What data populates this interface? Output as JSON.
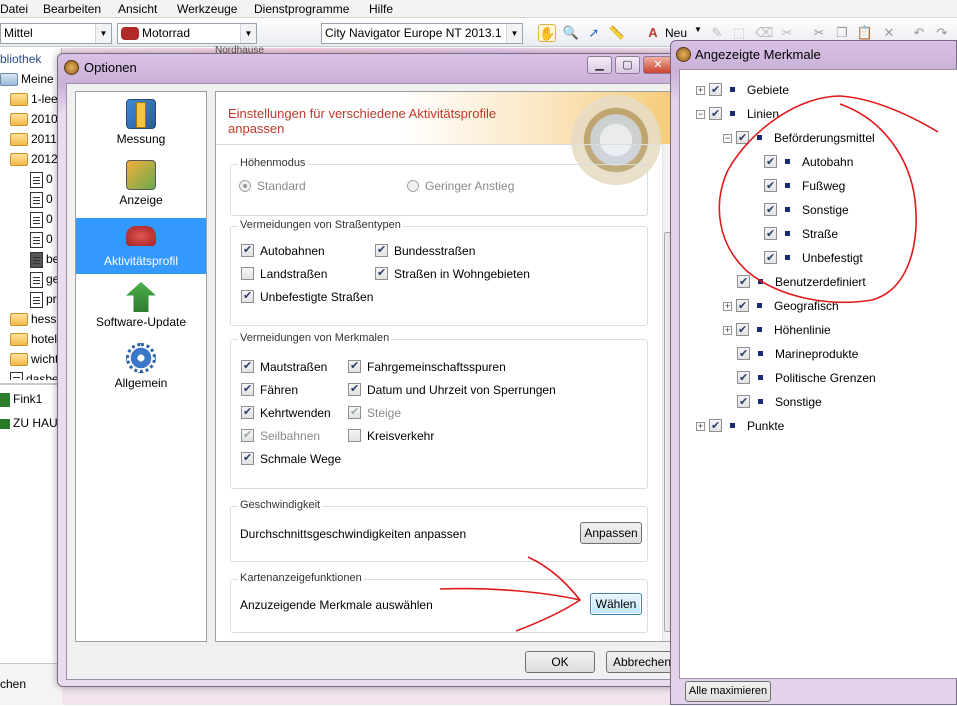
{
  "menubar": {
    "items": [
      "Datei",
      "Bearbeiten",
      "Ansicht",
      "Werkzeuge",
      "Dienstprogramme",
      "Hilfe"
    ]
  },
  "toolbar": {
    "detail_combo": "Mittel",
    "profile_combo": "Motorrad",
    "map_combo": "City Navigator Europe NT 2013.1",
    "new_label": "Neu"
  },
  "library": {
    "header": "bliothek",
    "root": "Meine Sa",
    "folders": [
      "1-lee",
      "2010",
      "2011",
      "2012"
    ],
    "docs": [
      "0",
      "0",
      "0",
      "0",
      "be",
      "ge",
      "pr"
    ],
    "folders2": [
      "hesse",
      "hotels",
      "wicht",
      "dasbe"
    ],
    "device": "Fink1",
    "device_child": "ZU HAUS",
    "search_label": "chen"
  },
  "map": {
    "label": "Nordhause"
  },
  "options_dialog": {
    "title": "Optionen",
    "nav": [
      {
        "label": "Messung",
        "icon": "ruler-icon"
      },
      {
        "label": "Anzeige",
        "icon": "display-icon"
      },
      {
        "label": "Aktivitätsprofil",
        "icon": "car-icon"
      },
      {
        "label": "Software-Update",
        "icon": "update-icon"
      },
      {
        "label": "Allgemein",
        "icon": "gear-icon"
      }
    ],
    "header_text": "Einstellungen für verschiedene Aktivitätsprofile anpassen",
    "elevation": {
      "title": "Höhenmodus",
      "standard": "Standard",
      "gentle": "Geringer Anstieg"
    },
    "road_avoid": {
      "title": "Vermeidungen von Straßentypen",
      "items": [
        "Autobahnen",
        "Bundesstraßen",
        "Landstraßen",
        "Straßen in Wohngebieten",
        "Unbefestigte Straßen"
      ]
    },
    "feature_avoid": {
      "title": "Vermeidungen von Merkmalen",
      "items": [
        "Mautstraßen",
        "Fahrgemeinschaftsspuren",
        "Fähren",
        "Datum und Uhrzeit von Sperrungen",
        "Kehrtwenden",
        "Steige",
        "Seilbahnen",
        "Kreisverkehr",
        "Schmale Wege"
      ]
    },
    "speed": {
      "title": "Geschwindigkeit",
      "text": "Durchschnittsgeschwindigkeiten anpassen",
      "button": "Anpassen"
    },
    "mapfeatures": {
      "title": "Kartenanzeigefunktionen",
      "text": "Anzuzeigende Merkmale auswählen",
      "button": "Wählen"
    },
    "ok": "OK",
    "cancel": "Abbrechen"
  },
  "features_window": {
    "title": "Angezeigte Merkmale",
    "tree": {
      "gebiete": "Gebiete",
      "linien": "Linien",
      "befoerderung": "Beförderungsmittel",
      "autobahn": "Autobahn",
      "fussweg": "Fußweg",
      "sonstige1": "Sonstige",
      "strasse": "Straße",
      "unbefestigt": "Unbefestigt",
      "benutzer": "Benutzerdefiniert",
      "geografisch": "Geografisch",
      "hoehenlinie": "Höhenlinie",
      "marine": "Marineprodukte",
      "politisch": "Politische Grenzen",
      "sonstige2": "Sonstige",
      "punkte": "Punkte"
    },
    "maximize_button": "Alle maximieren"
  },
  "colors": {
    "selected_nav": "#3399ff",
    "header_red": "#c0392b",
    "annotation": "#e0191b"
  }
}
